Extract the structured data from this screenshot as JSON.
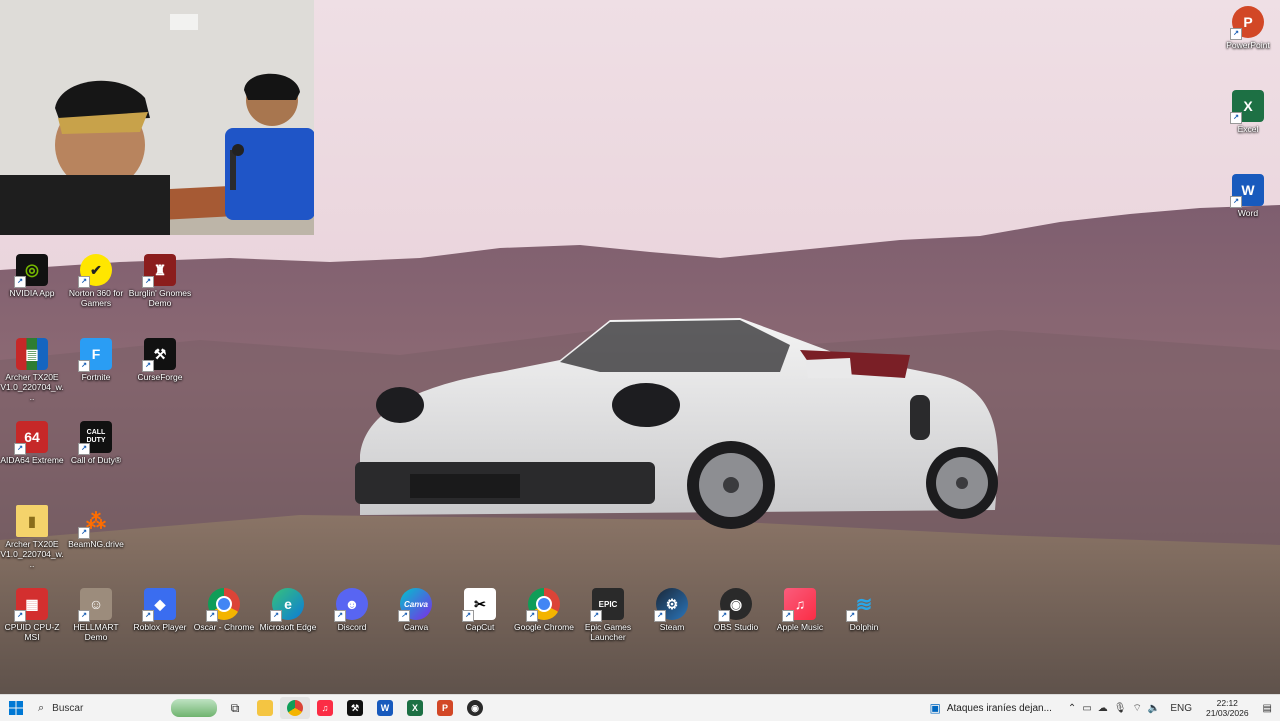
{
  "desktop_icons": {
    "nvidia": "NVIDIA App",
    "norton": "Norton 360 for Gamers",
    "burglin": "Burglin' Gnomes Demo",
    "archer1": "Archer TX20E V1.0_220704_w...",
    "fortnite": "Fortnite",
    "curseforge": "CurseForge",
    "aida": "AIDA64 Extreme",
    "cod": "Call of Duty®",
    "archer2": "Archer TX20E V1.0_220704_w...",
    "beamng": "BeamNG.drive",
    "cpuid": "CPUID CPU-Z MSI",
    "hellmart": "HELLMART Demo",
    "roblox": "Roblox Player",
    "oscar": "Oscar - Chrome",
    "edge": "Microsoft Edge",
    "discord": "Discord",
    "canva": "Canva",
    "capcut": "CapCut",
    "chrome": "Google Chrome",
    "epic": "Epic Games Launcher",
    "steam": "Steam",
    "obs": "OBS Studio",
    "applemusic": "Apple Music",
    "dolphin": "Dolphin",
    "powerpoint": "PowerPoint",
    "excel": "Excel",
    "word": "Word"
  },
  "icon_glyphs": {
    "aida": "64",
    "cod": "CALL\nDUTY",
    "canva": "Canva",
    "epic": "EPIC",
    "excel": "X",
    "word": "W",
    "powerpoint": "P",
    "fortnite": "F"
  },
  "taskbar": {
    "search_placeholder": "Buscar",
    "news_text": "Ataques iraníes dejan...",
    "language": "ENG",
    "time": "22:12",
    "date": "21/03/2026"
  },
  "colors": {
    "taskbar_bg": "#f3f3f3",
    "accent": "#0067c0"
  },
  "icons": [
    "windows-start-icon",
    "search-icon",
    "widgets-icon",
    "task-view-icon",
    "file-explorer-icon",
    "chrome-icon",
    "apple-music-icon",
    "curseforge-icon",
    "word-icon",
    "excel-icon",
    "powerpoint-icon",
    "obs-icon",
    "news-icon",
    "chevron-up-icon",
    "mic-icon",
    "network-icon",
    "volume-icon",
    "notification-icon"
  ]
}
